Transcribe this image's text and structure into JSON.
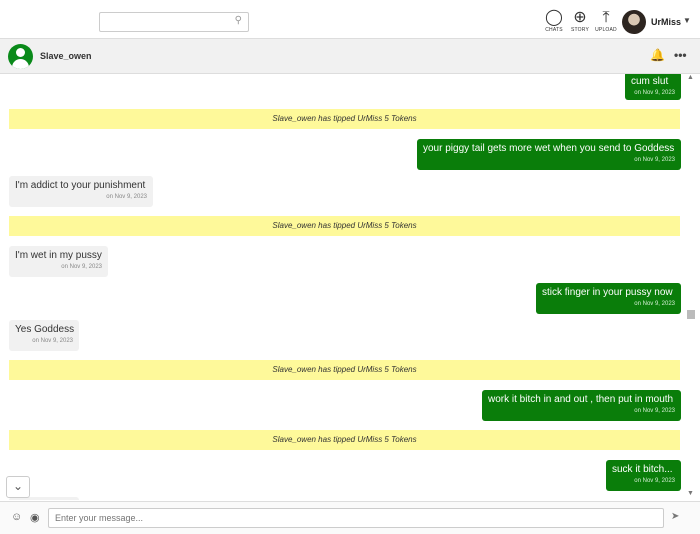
{
  "topbar": {
    "search_placeholder": "",
    "search_icon": "search-icon",
    "nav": [
      {
        "label": "CHATS",
        "icon": "chat-icon"
      },
      {
        "label": "STORY",
        "icon": "story-icon"
      },
      {
        "label": "UPLOAD",
        "icon": "upload-icon"
      }
    ],
    "username": "UrMiss"
  },
  "chat": {
    "name": "Slave_owen",
    "messages": [
      {
        "kind": "out",
        "text": "cum slut",
        "date": "on Nov 9, 2023"
      },
      {
        "kind": "tip",
        "text": "Slave_owen has tipped UrMiss 5 Tokens"
      },
      {
        "kind": "out",
        "text": "your piggy tail gets more wet when you send to Goddess",
        "date": "on Nov 9, 2023"
      },
      {
        "kind": "in",
        "text": "I'm addict to your punishment",
        "date": "on Nov 9, 2023"
      },
      {
        "kind": "tip",
        "text": "Slave_owen has tipped UrMiss 5 Tokens"
      },
      {
        "kind": "in",
        "text": "I'm wet in my pussy",
        "date": "on Nov 9, 2023"
      },
      {
        "kind": "out",
        "text": "stick finger in your pussy now",
        "date": "on Nov 9, 2023"
      },
      {
        "kind": "in",
        "text": "Yes Goddess",
        "date": "on Nov 9, 2023"
      },
      {
        "kind": "tip",
        "text": "Slave_owen has tipped UrMiss 5 Tokens"
      },
      {
        "kind": "out",
        "text": "work it bitch in and out , then put in mouth",
        "date": "on Nov 9, 2023"
      },
      {
        "kind": "tip",
        "text": "Slave_owen has tipped UrMiss 5 Tokens"
      },
      {
        "kind": "out",
        "text": "suck it bitch...",
        "date": "on Nov 9, 2023"
      }
    ]
  },
  "composer": {
    "placeholder": "Enter your message..."
  },
  "colors": {
    "outgoing": "#0a7d0a",
    "incoming": "#f1f1f1",
    "tip": "#fef99a"
  }
}
